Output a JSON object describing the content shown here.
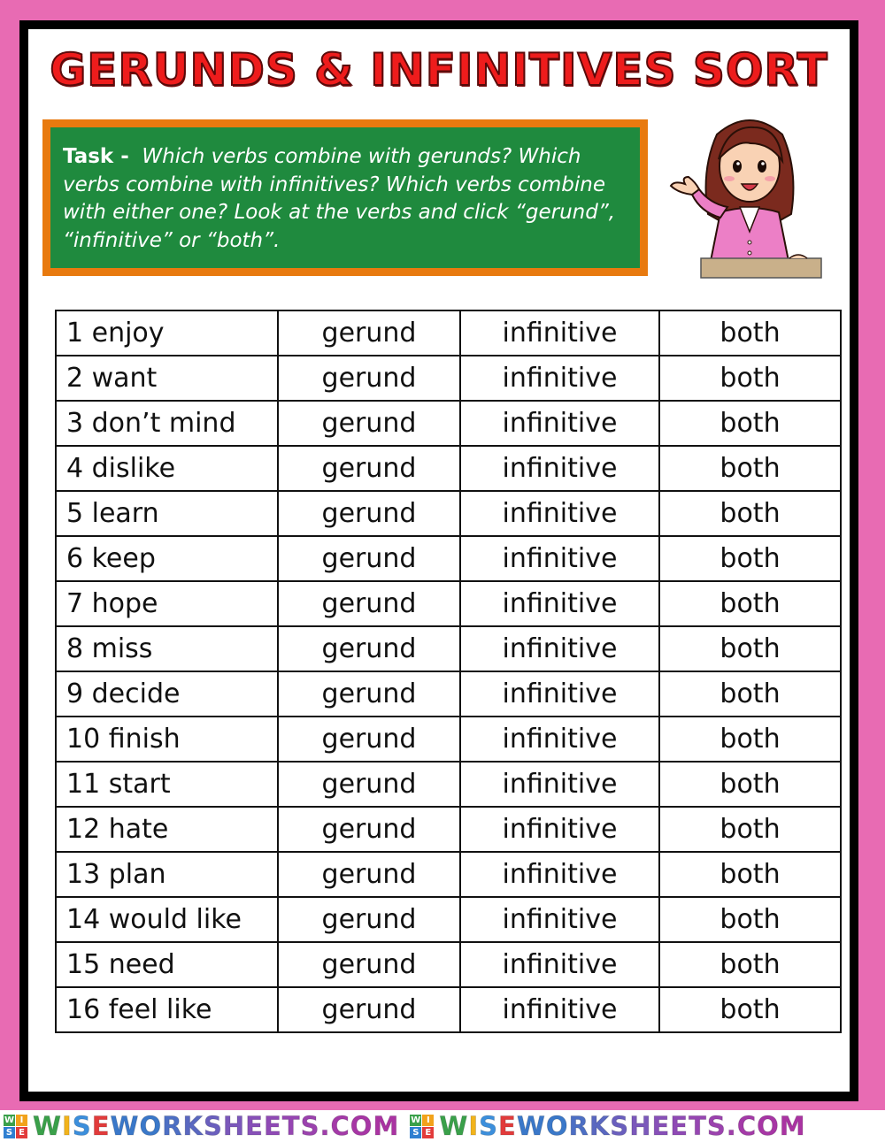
{
  "worksheet": {
    "title": "GERUNDS & INFINITIVES SORT",
    "task_label": "Task -",
    "task_text": "Which verbs combine with gerunds?  Which verbs combine with infinitives?  Which verbs combine with either one?  Look at the verbs and click “gerund”, “infinitive” or “both”.",
    "illustration": "teacher-pointing-icon"
  },
  "options": {
    "gerund": "gerund",
    "infinitive": "infinitive",
    "both": "both"
  },
  "rows": [
    {
      "verb": "1 enjoy",
      "gerund": "gerund",
      "infinitive": "infinitive",
      "both": "both"
    },
    {
      "verb": "2 want",
      "gerund": "gerund",
      "infinitive": "infinitive",
      "both": "both"
    },
    {
      "verb": "3 don’t mind",
      "gerund": "gerund",
      "infinitive": "infinitive",
      "both": "both"
    },
    {
      "verb": "4 dislike",
      "gerund": "gerund",
      "infinitive": "infinitive",
      "both": "both"
    },
    {
      "verb": "5 learn",
      "gerund": "gerund",
      "infinitive": "infinitive",
      "both": "both"
    },
    {
      "verb": "6 keep",
      "gerund": "gerund",
      "infinitive": "infinitive",
      "both": "both"
    },
    {
      "verb": "7 hope",
      "gerund": "gerund",
      "infinitive": "infinitive",
      "both": "both"
    },
    {
      "verb": "8 miss",
      "gerund": "gerund",
      "infinitive": "infinitive",
      "both": "both"
    },
    {
      "verb": "9 decide",
      "gerund": "gerund",
      "infinitive": "infinitive",
      "both": "both"
    },
    {
      "verb": "10 finish",
      "gerund": "gerund",
      "infinitive": "infinitive",
      "both": "both"
    },
    {
      "verb": "11 start",
      "gerund": "gerund",
      "infinitive": "infinitive",
      "both": "both"
    },
    {
      "verb": "12 hate",
      "gerund": "gerund",
      "infinitive": "infinitive",
      "both": "both"
    },
    {
      "verb": "13 plan",
      "gerund": "gerund",
      "infinitive": "infinitive",
      "both": "both"
    },
    {
      "verb": "14 would like",
      "gerund": "gerund",
      "infinitive": "infinitive",
      "both": "both"
    },
    {
      "verb": "15 need",
      "gerund": "gerund",
      "infinitive": "infinitive",
      "both": "both"
    },
    {
      "verb": "16 feel like",
      "gerund": "gerund",
      "infinitive": "infinitive",
      "both": "both"
    }
  ],
  "footer": {
    "logo_letters": [
      "W",
      "I",
      "S",
      "E"
    ],
    "logo_colors": [
      "#3aa04a",
      "#f2a21b",
      "#2f7fd1",
      "#e23b3b"
    ],
    "brand_text": "WISEWORKSHEETS.COM",
    "brand_repeats": 2,
    "brand_letter_colors": [
      "#3aa04a",
      "#f2b31b",
      "#3c8fdc",
      "#e23b3b",
      "#3a78c9",
      "#3a78c9",
      "#4d6fc4",
      "#5a68c0",
      "#6a5fbe",
      "#7b58bb",
      "#8750b8",
      "#8f4ab5",
      "#9646b2",
      "#9b42ae",
      "#a03eab",
      "#a43aa8",
      "#a736a5",
      "#aa33a2"
    ]
  },
  "colors": {
    "page_background": "#e86bb3",
    "frame": "#000000",
    "title_red": "#ee1c1c",
    "task_border_orange": "#e87a0f",
    "task_green": "#1f8a3e"
  }
}
